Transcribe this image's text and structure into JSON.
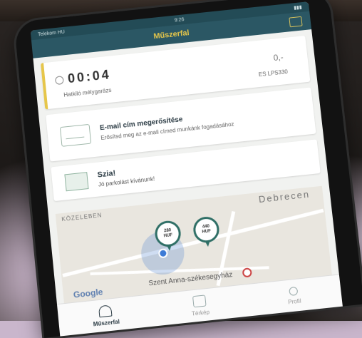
{
  "app": {
    "title": "Műszerfal"
  },
  "statusbar": {
    "carrier": "Telekom HU",
    "time": "9:26"
  },
  "session": {
    "timer": "00:04",
    "price_label": "0,-",
    "zone_label": "Hatkiló mélygarázs",
    "plate": "ES LPS330"
  },
  "email_card": {
    "title": "E-mail cím megerősítése",
    "subtitle": "Erősítsd meg az e-mail címed munkánk fogadásához"
  },
  "greeting_card": {
    "title": "Szia!",
    "subtitle": "Jó parkolást kívánunk!"
  },
  "nearby": {
    "label": "KÖZELEBEN",
    "city": "Debrecen",
    "markers": [
      {
        "price": "280",
        "currency": "HUF"
      },
      {
        "price": "440",
        "currency": "HUF"
      }
    ],
    "map_attribution": "Google",
    "poi": "Szent Anna-székesegyház"
  },
  "tabs": [
    {
      "label": "Műszerfal",
      "icon": "gauge-icon",
      "active": true
    },
    {
      "label": "Térkép",
      "icon": "map-icon",
      "active": false
    },
    {
      "label": "Profil",
      "icon": "person-icon",
      "active": false
    }
  ]
}
